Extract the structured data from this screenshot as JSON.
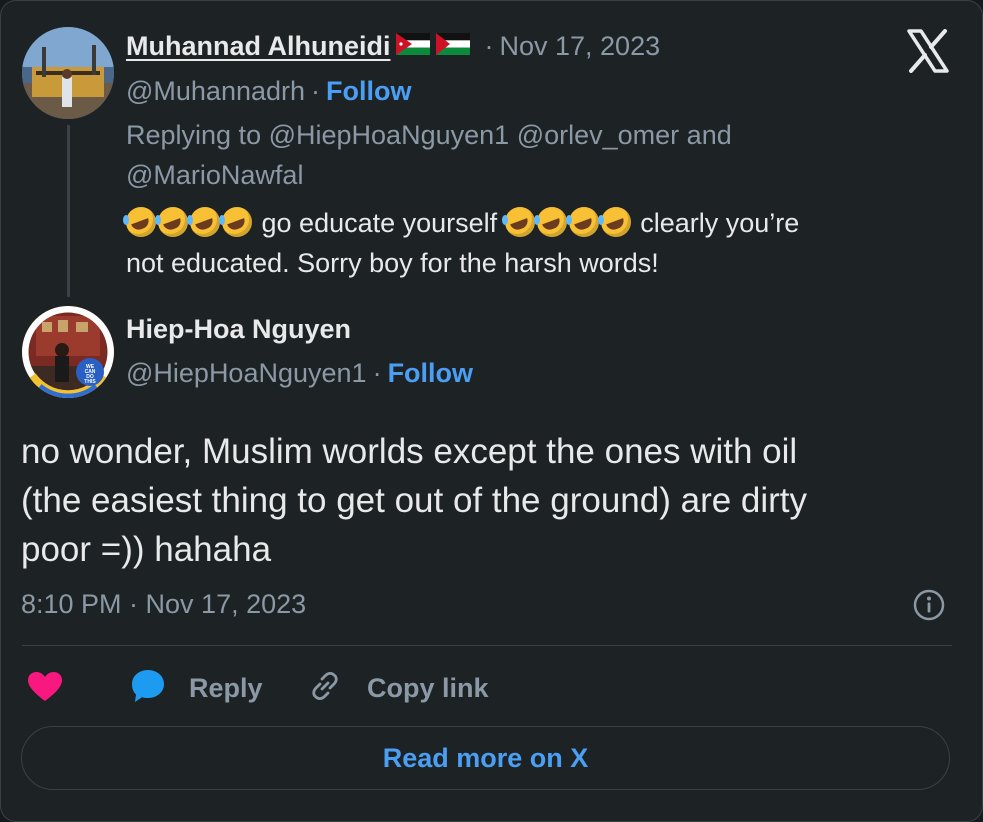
{
  "reply_tweet": {
    "author_name": "Muhannad Alhuneidi",
    "handle": "@Muhannadrh",
    "date_sep": "·",
    "date": "Nov 17, 2023",
    "follow_label": "Follow",
    "replying_to_prefix": "Replying to",
    "replying_mention_1": "@HiepHoaNguyen1",
    "replying_mention_2": "@orlev_omer",
    "replying_and": "and",
    "replying_mention_3": "@MarioNawfal",
    "text_1": "go educate yourself",
    "text_2": "clearly you’re",
    "text_3": "not educated. Sorry boy for the harsh words!",
    "emoji": "rolling-on-floor-laughing"
  },
  "main_tweet": {
    "author_name": "Hiep-Hoa Nguyen",
    "handle": "@HiepHoaNguyen1",
    "follow_label": "Follow",
    "avatar_badge": "WE CAN DO THIS",
    "avatar_ring_text": "I GOT MY COVID-19 VA",
    "text_line_1": "no wonder, Muslim worlds except the ones with oil",
    "text_line_2": "(the easiest thing to get out of the ground) are dirty",
    "text_line_3": "poor =)) hahaha",
    "timestamp": "8:10 PM · Nov 17, 2023"
  },
  "actions": {
    "reply_label": "Reply",
    "copy_link_label": "Copy link",
    "read_more_label": "Read more on X"
  },
  "colors": {
    "accent": "#4a9ff5",
    "like": "#f91880",
    "background": "#1d2224",
    "muted": "#8b98a5"
  },
  "icons": [
    "x-logo-icon",
    "heart-icon",
    "reply-bubble-icon",
    "link-icon",
    "info-icon",
    "jordan-flag-icon",
    "palestine-flag-icon"
  ]
}
